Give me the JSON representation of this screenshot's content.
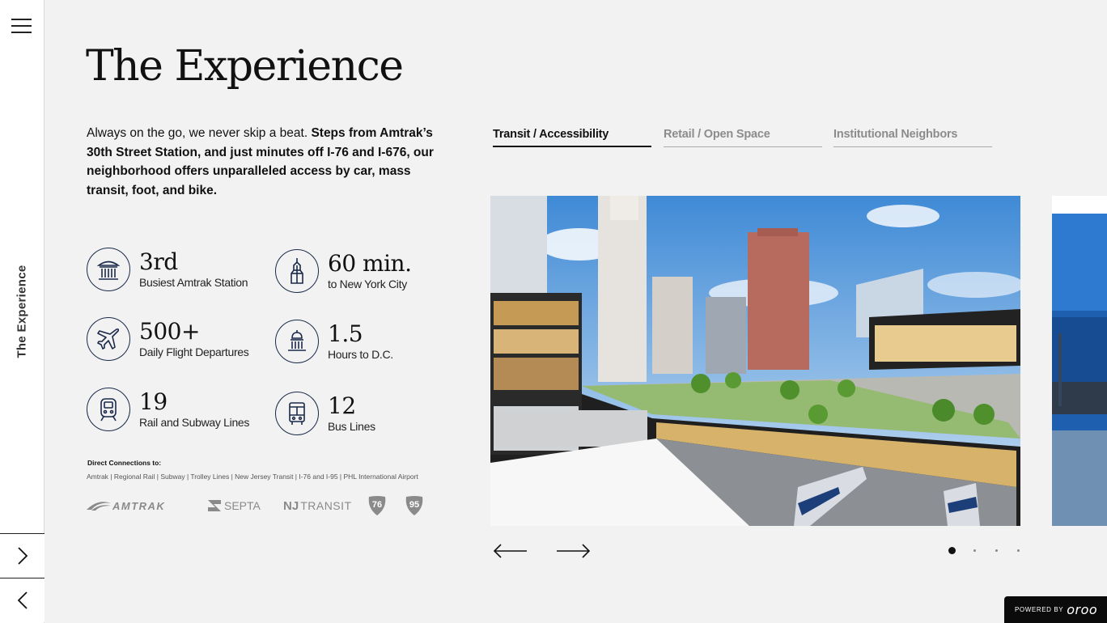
{
  "rail": {
    "section_label": "The Experience"
  },
  "page": {
    "title": "The Experience",
    "intro_plain": "Always on the go, we never skip a beat. ",
    "intro_bold": "Steps from Amtrak’s 30th Street Station, and just minutes off I-76 and I-676, our neighborhood offers unparalleled access by car, mass transit, foot, and bike."
  },
  "stats": [
    {
      "value": "3rd",
      "label": "Busiest Amtrak Station",
      "icon": "train-station-icon"
    },
    {
      "value": "60 min.",
      "label": "to New York City",
      "icon": "skyscraper-icon"
    },
    {
      "value": "500+",
      "label": "Daily Flight Departures",
      "icon": "airplane-icon"
    },
    {
      "value": "1.5",
      "label": "Hours to D.C.",
      "icon": "capitol-icon"
    },
    {
      "value": "19",
      "label": "Rail and Subway Lines",
      "icon": "train-icon"
    },
    {
      "value": "12",
      "label": "Bus Lines",
      "icon": "bus-icon"
    }
  ],
  "connections": {
    "title": "Direct Connections to:",
    "list": "Amtrak  |  Regional Rail  |  Subway  |  Trolley Lines  |  New Jersey Transit  |  I-76 and I-95  |  PHL International Airport"
  },
  "logos": {
    "amtrak": "AMTRAK",
    "septa": "SEPTA",
    "nj_transit": "TRANSIT",
    "nj_mark": "NJ",
    "route_76": "76",
    "route_95": "95"
  },
  "tabs": [
    {
      "label": "Transit / Accessibility",
      "active": true
    },
    {
      "label": "Retail / Open Space",
      "active": false
    },
    {
      "label": "Institutional Neighbors",
      "active": false
    }
  ],
  "carousel": {
    "slide_count": 4,
    "active_index": 0
  },
  "footer": {
    "powered_by": "POWERED BY",
    "brand": "oroo"
  },
  "colors": {
    "background": "#f2f2f2",
    "icon_navy": "#1b2a4a",
    "accent_dark": "#111111",
    "logo_gray": "#8a8a8a"
  }
}
